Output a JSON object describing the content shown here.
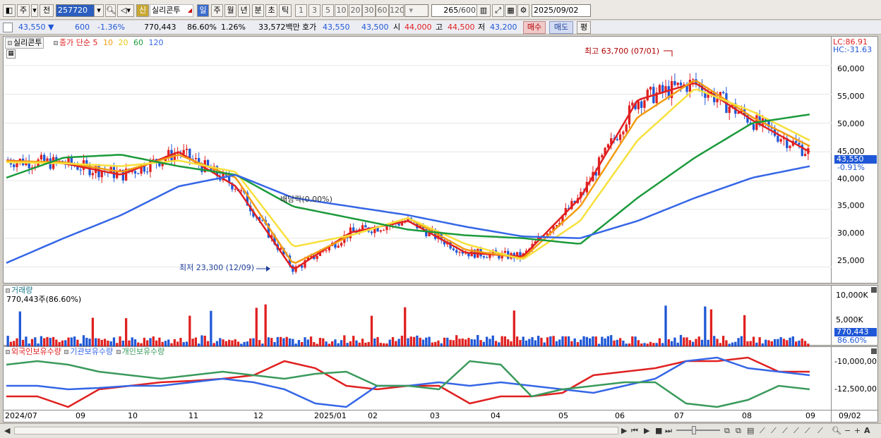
{
  "toolbar": {
    "period_short": "주",
    "prev_label": "전",
    "stock_code": "257720",
    "credit_badge": "신",
    "stock_name": "실리콘투",
    "periods": [
      "일",
      "주",
      "월",
      "년",
      "분",
      "초",
      "틱"
    ],
    "minutes": [
      "1",
      "3",
      "5",
      "10",
      "20",
      "30",
      "60",
      "120"
    ],
    "count_value": "265",
    "count_max": "/600",
    "date_value": "2025/09/02"
  },
  "quote": {
    "price": "43,550",
    "direction": "▼",
    "change": "600",
    "change_pct": "-1.36%",
    "volume": "770,443",
    "volume_pct": "86.60%",
    "turnover": "1.26%",
    "amount": "33,572백만",
    "bid_ask_label": "호가",
    "ask": "43,550",
    "bid": "43,500",
    "open_label": "시",
    "open": "44,000",
    "high_label": "고",
    "high": "44,500",
    "low_label": "저",
    "low": "43,200",
    "buy_label": "매수",
    "sell_label": "매도",
    "eval_label": "평"
  },
  "price_panel": {
    "stock_tag": "실리콘투",
    "legend": [
      "종가",
      "단순",
      "5",
      "10",
      "20",
      "60",
      "120"
    ],
    "lc": "LC:86.91",
    "hc": "HC:-31.63",
    "current_price": "43,550",
    "current_pct": "-0.91%",
    "high_note": "최고 63,700 (07/01)",
    "low_note": "최저 23,300 (12/09)",
    "dividend_note": "배당락(0.00%)",
    "y_ticks": [
      "60,000",
      "55,000",
      "50,000",
      "45,000",
      "40,000",
      "35,000",
      "30,000",
      "25,000"
    ]
  },
  "volume_panel": {
    "title": "거래량",
    "info": "770,443주(86.60%)",
    "y_ticks": [
      "10,000K",
      "5,000K"
    ],
    "badge": "770,443",
    "badge_pct": "86.60%"
  },
  "holdings_panel": {
    "legend": [
      "외국인보유수량",
      "기관보유수량",
      "개인보유수량"
    ],
    "y_ticks": [
      "-10,000,00",
      "-12,500,00"
    ]
  },
  "x_axis": {
    "labels": [
      "2024/07",
      "09",
      "10",
      "11",
      "12",
      "2025/01",
      "02",
      "03",
      "04",
      "05",
      "06",
      "07",
      "08",
      "09"
    ],
    "right_label": "09/02"
  },
  "colors": {
    "ma5": "#e02020",
    "ma10": "#f39c12",
    "ma20": "#f7e03c",
    "ma60": "#1b9a3b",
    "ma120": "#3566e6",
    "up": "#e02020",
    "down": "#1f57d6",
    "foreign": "#e02020",
    "inst": "#3566e6",
    "indiv": "#3a9a5c"
  },
  "chart_data": {
    "type": "candlestick",
    "x": [
      "2024/07",
      "2024/08",
      "2024/09",
      "2024/10",
      "2024/11",
      "2024/12",
      "2025/01",
      "2025/02",
      "2025/03",
      "2025/04",
      "2025/05",
      "2025/06",
      "2025/07",
      "2025/08",
      "2025/09"
    ],
    "series": [
      {
        "name": "5",
        "values": [
          43500,
          43000,
          41000,
          45000,
          39000,
          24500,
          31000,
          33000,
          27500,
          26800,
          37000,
          54000,
          57000,
          50500,
          45000
        ]
      },
      {
        "name": "10",
        "values": [
          43400,
          43200,
          41500,
          44500,
          40500,
          25500,
          30500,
          33500,
          28000,
          26500,
          35500,
          51000,
          57500,
          51000,
          46000
        ]
      },
      {
        "name": "20",
        "values": [
          43200,
          43000,
          42500,
          43500,
          41500,
          28500,
          30500,
          33500,
          29000,
          26300,
          33000,
          47000,
          56000,
          52000,
          47000
        ]
      },
      {
        "name": "60",
        "values": [
          40500,
          44000,
          44500,
          42500,
          41000,
          35500,
          33500,
          31500,
          30500,
          30000,
          29000,
          37000,
          44000,
          50000,
          51500
        ]
      },
      {
        "name": "120",
        "values": [
          25700,
          30000,
          34000,
          39000,
          41000,
          37000,
          35500,
          34000,
          32000,
          30300,
          30000,
          33000,
          37000,
          40500,
          42500
        ]
      }
    ],
    "ylim": [
      22000,
      65000
    ],
    "high": 63700,
    "low": 23300
  }
}
